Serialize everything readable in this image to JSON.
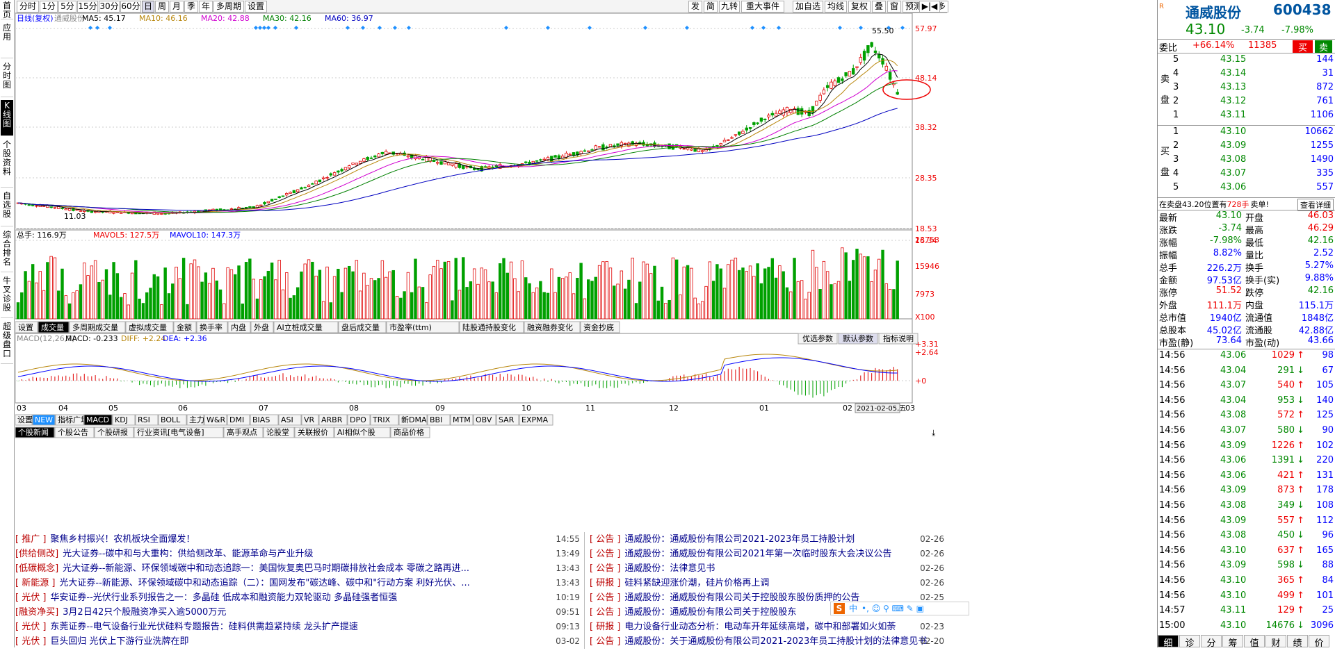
{
  "sidenav": [
    "首页",
    "应用",
    "分时图",
    "K线图",
    "个股资料",
    "自选股",
    "综合排名",
    "牛叉诊股",
    "超级盘口"
  ],
  "periods": [
    "分时",
    "1分",
    "5分",
    "15分",
    "30分",
    "60分",
    "日",
    "周",
    "月",
    "季",
    "年",
    "多周期",
    "设置"
  ],
  "tools": [
    "发",
    "简",
    "九转",
    "重大事件",
    "加自选",
    "均线",
    "复权",
    "叠",
    "窗",
    "预测",
    "更多"
  ],
  "main_legend": {
    "title": "日线(复权)",
    "stock": "通威股份",
    "ma5": "MA5: 45.17",
    "ma10": "MA10: 46.16",
    "ma20": "MA20: 42.88",
    "ma30": "MA30: 42.16",
    "ma60": "MA60: 36.97"
  },
  "price_axis": [
    "57.97",
    "48.14",
    "38.32",
    "28.35",
    "18.53",
    "16.34"
  ],
  "price_marks": {
    "high": "55.50",
    "low": "11.03"
  },
  "vol_legend": {
    "total": "总手: 116.9万",
    "mavol5": "MAVOL5: 127.5万",
    "mavol10": "MAVOL10: 147.3万"
  },
  "vol_axis": [
    "23753",
    "15946",
    "7973",
    "X100"
  ],
  "sub_tabs": [
    "设置",
    "成交量",
    "多周期成交量",
    "虚拟成交量",
    "金额",
    "换手率",
    "内盘",
    "外盘",
    "AI立桩成交量",
    "盘后成交量",
    "市盈率(ttm)",
    "陆股通持股变化",
    "融资融券变化",
    "资金抄底"
  ],
  "macd_legend": {
    "title": "MACD(12,26,9)",
    "macd": "MACD: -0.233",
    "diff": "DIFF: +2.24",
    "dea": "DEA: +2.36"
  },
  "macd_axis": [
    "+3.31",
    "+2.64",
    "+0"
  ],
  "macd_btns": [
    "优选参数",
    "默认参数",
    "指标说明"
  ],
  "months": [
    "03",
    "04",
    "05",
    "06",
    "07",
    "08",
    "09",
    "10",
    "11",
    "12",
    "01",
    "02",
    "03"
  ],
  "date_label": "2021-02-05,五",
  "ind_tabs": [
    "设置",
    "NEW",
    "指标广场",
    "MACD",
    "KDJ",
    "RSI",
    "BOLL",
    "主力",
    "W&R",
    "DMI",
    "BIAS",
    "ASI",
    "VR",
    "ARBR",
    "DPO",
    "TRIX",
    "新DMA",
    "BBI",
    "MTM",
    "OBV",
    "SAR",
    "EXPMA"
  ],
  "news_tabs": [
    "个股新闻",
    "个股公告",
    "个股研报",
    "行业资讯[电气设备]",
    "高手观点",
    "论股堂",
    "关联报价",
    "AI相似个股",
    "商品价格"
  ],
  "news_left": [
    {
      "tag": "[ 推广 ]",
      "title": "聚焦乡村振兴！农机板块全面爆发！",
      "time": "14:55"
    },
    {
      "tag": "[供给侧改]",
      "title": "光大证券--碳中和与大重构：供给侧改革、能源革命与产业升级",
      "time": "13:49"
    },
    {
      "tag": "[低碳概念]",
      "title": "光大证券--新能源、环保领域碳中和动态追踪一：美国恢复奥巴马时期碳排放社会成本 零碳之路再进...",
      "time": "13:43"
    },
    {
      "tag": "[ 新能源 ]",
      "title": "光大证券--新能源、环保领域碳中和动态追踪（二）：国网发布\"碳达峰、碳中和\"行动方案 利好光伏、...",
      "time": "13:43"
    },
    {
      "tag": "[ 光伏 ]",
      "title": "华安证券--光伏行业系列报告之一：多晶硅 低成本和融资能力双轮驱动 多晶硅强者恒强",
      "time": "10:19"
    },
    {
      "tag": "[融资净买]",
      "title": "3月2日42只个股融资净买入逾5000万元",
      "time": "09:51"
    },
    {
      "tag": "[ 光伏 ]",
      "title": "东莞证券--电气设备行业光伏硅料专题报告：硅料供需趋紧持续 龙头扩产提速",
      "time": "09:13"
    },
    {
      "tag": "[ 光伏 ]",
      "title": "巨头回归 光伏上下游行业洗牌在即",
      "time": "03-02"
    }
  ],
  "news_right": [
    {
      "tag": "[ 公告 ]",
      "title": "通威股份：通威股份有限公司2021-2023年员工持股计划",
      "time": "02-26"
    },
    {
      "tag": "[ 公告 ]",
      "title": "通威股份：通威股份有限公司2021年第一次临时股东大会决议公告",
      "time": "02-26"
    },
    {
      "tag": "[ 公告 ]",
      "title": "通威股份：法律意见书",
      "time": "02-26"
    },
    {
      "tag": "[ 研报 ]",
      "title": "硅料紧缺迎涨价潮，硅片价格再上调",
      "time": "02-26"
    },
    {
      "tag": "[ 公告 ]",
      "title": "通威股份：通威股份有限公司关于控股股东股份质押的公告",
      "time": "02-25"
    },
    {
      "tag": "[ 公告 ]",
      "title": "通威股份：通威股份有限公司关于控股股东",
      "time": "02-23"
    },
    {
      "tag": "[ 研报 ]",
      "title": "电力设备行业动态分析：电动车开年延续高增，碳中和部署如火如荼",
      "time": "02-23"
    },
    {
      "tag": "[ 公告 ]",
      "title": "通威股份：关于通威股份有限公司2021-2023年员工持股计划的法律意见书",
      "time": "02-20"
    }
  ],
  "quote": {
    "name": "通威股份",
    "code": "600438",
    "price": "43.10",
    "change": "-3.74",
    "pct": "-7.98%",
    "wb_label": "委比",
    "wb": "+66.14%",
    "wc": "11385",
    "buy": "买",
    "sell": "卖"
  },
  "asks": [
    {
      "n": "5",
      "p": "43.15",
      "v": "144"
    },
    {
      "n": "4",
      "p": "43.14",
      "v": "31"
    },
    {
      "n": "3",
      "p": "43.13",
      "v": "872"
    },
    {
      "n": "2",
      "p": "43.12",
      "v": "761"
    },
    {
      "n": "1",
      "p": "43.11",
      "v": "1106"
    }
  ],
  "bids": [
    {
      "n": "1",
      "p": "43.10",
      "v": "10662"
    },
    {
      "n": "2",
      "p": "43.09",
      "v": "1255"
    },
    {
      "n": "3",
      "p": "43.08",
      "v": "1490"
    },
    {
      "n": "4",
      "p": "43.07",
      "v": "335"
    },
    {
      "n": "5",
      "p": "43.06",
      "v": "557"
    }
  ],
  "sell_side": "卖盘",
  "buy_side": "买盘",
  "notice": {
    "text": "在卖盘43.20位置有",
    "vol": "728手",
    "act": "卖单!",
    "more": "查看详细"
  },
  "stats": [
    {
      "l": "最新",
      "v": "43.10",
      "l2": "开盘",
      "v2": "46.03"
    },
    {
      "l": "涨跌",
      "v": "-3.74",
      "l2": "最高",
      "v2": "46.29"
    },
    {
      "l": "涨幅",
      "v": "-7.98%",
      "l2": "最低",
      "v2": "42.16"
    },
    {
      "l": "振幅",
      "v": "8.82%",
      "l2": "量比",
      "v2": "2.52"
    },
    {
      "l": "总手",
      "v": "226.2万",
      "l2": "换手",
      "v2": "5.27%"
    },
    {
      "l": "金额",
      "v": "97.53亿",
      "l2": "换手(实)",
      "v2": "9.88%"
    },
    {
      "l": "涨停",
      "v": "51.52",
      "l2": "跌停",
      "v2": "42.16"
    },
    {
      "l": "外盘",
      "v": "111.1万",
      "l2": "内盘",
      "v2": "115.1万"
    },
    {
      "l": "总市值",
      "v": "1940亿",
      "l2": "流通值",
      "v2": "1848亿"
    },
    {
      "l": "总股本",
      "v": "45.02亿",
      "l2": "流通股",
      "v2": "42.88亿"
    },
    {
      "l": "市盈(静)",
      "v": "73.64",
      "l2": "市盈(动)",
      "v2": "43.66"
    }
  ],
  "ticks": [
    {
      "t": "14:56",
      "p": "43.06",
      "v": "1029",
      "d": "up",
      "n": "98"
    },
    {
      "t": "14:56",
      "p": "43.04",
      "v": "291",
      "d": "dn",
      "n": "67"
    },
    {
      "t": "14:56",
      "p": "43.07",
      "v": "540",
      "d": "up",
      "n": "105"
    },
    {
      "t": "14:56",
      "p": "43.04",
      "v": "953",
      "d": "dn",
      "n": "140"
    },
    {
      "t": "14:56",
      "p": "43.08",
      "v": "572",
      "d": "up",
      "n": "125"
    },
    {
      "t": "14:56",
      "p": "43.07",
      "v": "580",
      "d": "dn",
      "n": "90"
    },
    {
      "t": "14:56",
      "p": "43.09",
      "v": "1226",
      "d": "up",
      "n": "102"
    },
    {
      "t": "14:56",
      "p": "43.06",
      "v": "1391",
      "d": "dn",
      "n": "220"
    },
    {
      "t": "14:56",
      "p": "43.06",
      "v": "421",
      "d": "up",
      "n": "131"
    },
    {
      "t": "14:56",
      "p": "43.09",
      "v": "873",
      "d": "up",
      "n": "178"
    },
    {
      "t": "14:56",
      "p": "43.08",
      "v": "349",
      "d": "dn",
      "n": "108"
    },
    {
      "t": "14:56",
      "p": "43.09",
      "v": "557",
      "d": "up",
      "n": "112"
    },
    {
      "t": "14:56",
      "p": "43.08",
      "v": "450",
      "d": "dn",
      "n": "96"
    },
    {
      "t": "14:56",
      "p": "43.10",
      "v": "637",
      "d": "up",
      "n": "165"
    },
    {
      "t": "14:56",
      "p": "43.09",
      "v": "598",
      "d": "dn",
      "n": "88"
    },
    {
      "t": "14:56",
      "p": "43.10",
      "v": "365",
      "d": "up",
      "n": "84"
    },
    {
      "t": "14:56",
      "p": "43.10",
      "v": "499",
      "d": "up",
      "n": "101"
    },
    {
      "t": "14:57",
      "p": "43.11",
      "v": "129",
      "d": "up",
      "n": "25"
    },
    {
      "t": "15:00",
      "p": "43.10",
      "v": "14676",
      "d": "dn",
      "n": "3096"
    }
  ],
  "bottom_tabs": [
    "细",
    "诊",
    "分",
    "筹",
    "值",
    "财",
    "绩",
    "价"
  ],
  "ime": "中",
  "colors": {
    "up": "#e00000",
    "down": "#00a000",
    "ma5": "#000000",
    "ma10": "#b8860b",
    "ma20": "#d000d0",
    "ma30": "#008000",
    "ma60": "#0000c0"
  }
}
